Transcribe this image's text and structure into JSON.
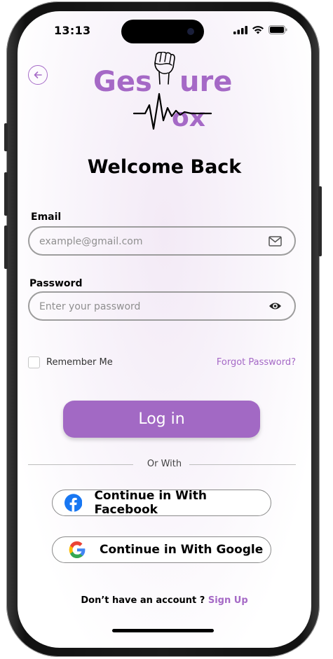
{
  "status_bar": {
    "time": "13:13"
  },
  "logo": {
    "line1_part1": "Ges",
    "line1_part2": "ure",
    "line2_part": "ox"
  },
  "title": "Welcome Back",
  "email": {
    "label": "Email",
    "placeholder": "example@gmail.com"
  },
  "password": {
    "label": "Password",
    "placeholder": "Enter your password"
  },
  "remember_label": "Remember Me",
  "forgot_label": "Forgot Password?",
  "login_label": "Log in",
  "divider_label": "Or With",
  "facebook_label": "Continue in With Facebook",
  "google_label": "Continue in With Google",
  "signup": {
    "prompt": "Don’t have an account ? ",
    "link": "Sign Up"
  },
  "colors": {
    "accent": "#a569c6",
    "button": "#a269c4",
    "facebook": "#1877f2"
  }
}
